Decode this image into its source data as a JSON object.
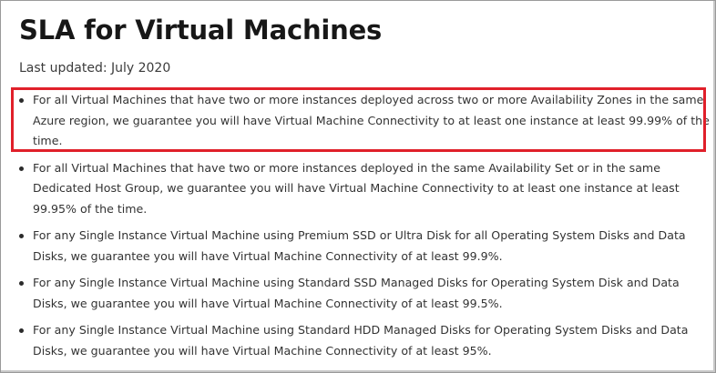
{
  "page": {
    "title": "SLA for Virtual Machines",
    "last_updated": "Last updated: July 2020"
  },
  "items": [
    {
      "lines": [
        "For all Virtual Machines that have two or more instances deployed across two or more Availability Zones in the same",
        "Azure region, we guarantee you will have Virtual Machine Connectivity to at least one instance at least 99.99% of the",
        "time."
      ],
      "highlighted": true
    },
    {
      "lines": [
        "For all Virtual Machines that have two or more instances deployed in the same Availability Set or in the same",
        "Dedicated Host Group, we guarantee you will have Virtual Machine Connectivity to at least one instance at least",
        "99.95% of the time."
      ],
      "highlighted": false
    },
    {
      "lines": [
        "For any Single Instance Virtual Machine using Premium SSD or Ultra Disk for all Operating System Disks and Data",
        "Disks, we guarantee you will have Virtual Machine Connectivity of at least 99.9%."
      ],
      "highlighted": false
    },
    {
      "lines": [
        "For any Single Instance Virtual Machine using Standard SSD Managed Disks for Operating System Disk and Data",
        "Disks, we guarantee you will have Virtual Machine Connectivity of at least 99.5%."
      ],
      "highlighted": false
    },
    {
      "lines": [
        "For any Single Instance Virtual Machine using Standard HDD Managed Disks for Operating System Disks and Data",
        "Disks, we guarantee you will have Virtual Machine Connectivity of at least 95%."
      ],
      "highlighted": false
    }
  ],
  "colors": {
    "highlight_border": "#e0202a",
    "text": "#333333",
    "heading": "#171717"
  }
}
